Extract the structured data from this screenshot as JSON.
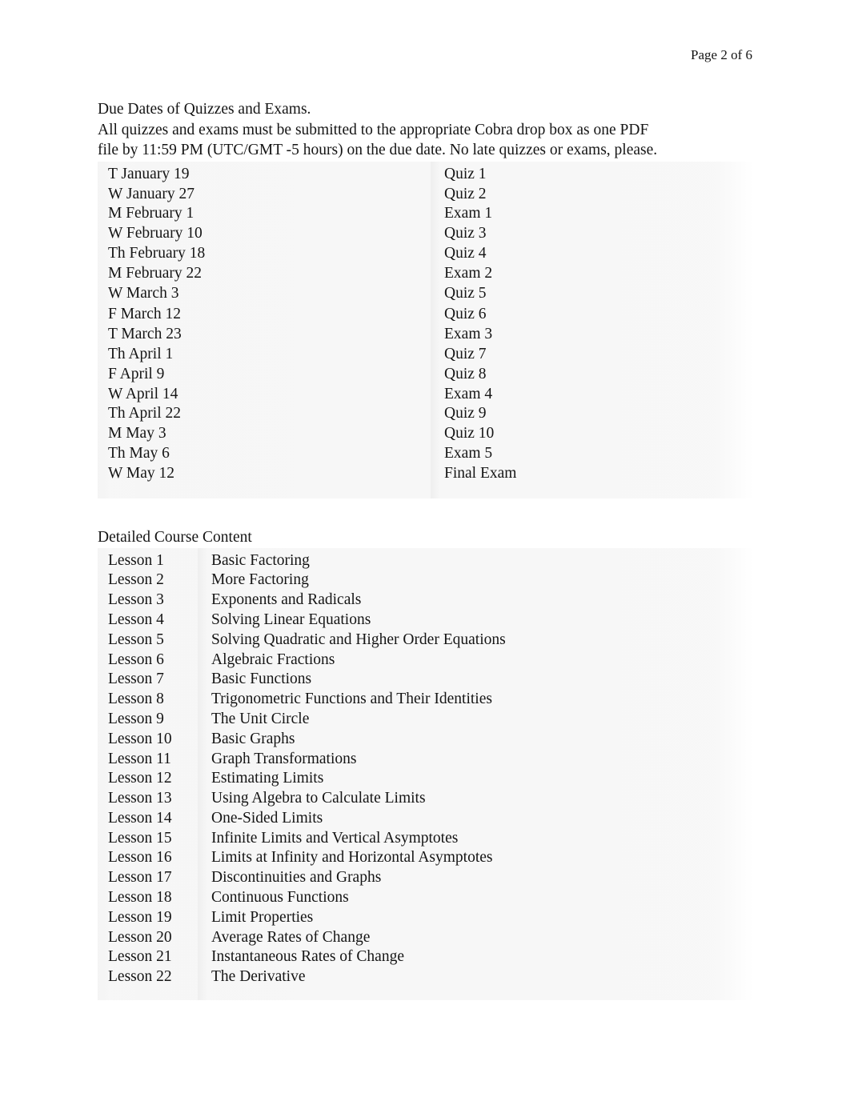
{
  "header": {
    "page_indicator": "Page 2 of 6"
  },
  "intro": {
    "heading": "Due Dates of Quizzes and Exams.",
    "line1": "All quizzes and exams must be submitted to the appropriate Cobra drop box as one PDF",
    "line2": "file by 11:59 PM (UTC/GMT -5 hours) on the due date. No late quizzes or exams, please."
  },
  "due_dates": {
    "rows": [
      {
        "date": "T January 19",
        "assessment": "Quiz 1"
      },
      {
        "date": "W January 27",
        "assessment": "Quiz 2"
      },
      {
        "date": "M February 1",
        "assessment": "Exam 1"
      },
      {
        "date": "W February 10",
        "assessment": "Quiz 3"
      },
      {
        "date": "Th February 18",
        "assessment": "Quiz 4"
      },
      {
        "date": "M February 22",
        "assessment": "Exam 2"
      },
      {
        "date": "W March 3",
        "assessment": "Quiz 5"
      },
      {
        "date": "F March 12",
        "assessment": "Quiz 6"
      },
      {
        "date": "T March 23",
        "assessment": "Exam 3"
      },
      {
        "date": "Th April 1",
        "assessment": "Quiz 7"
      },
      {
        "date": "F April 9",
        "assessment": "Quiz 8"
      },
      {
        "date": "W April 14",
        "assessment": "Exam 4"
      },
      {
        "date": "Th April 22",
        "assessment": "Quiz 9"
      },
      {
        "date": "M May 3",
        "assessment": "Quiz 10"
      },
      {
        "date": "Th May 6",
        "assessment": "Exam 5"
      },
      {
        "date": "W May 12",
        "assessment": "Final Exam"
      }
    ]
  },
  "course_content": {
    "heading": "Detailed Course Content",
    "rows": [
      {
        "lesson": "Lesson 1",
        "topic": "Basic Factoring"
      },
      {
        "lesson": "Lesson 2",
        "topic": "More Factoring"
      },
      {
        "lesson": "Lesson 3",
        "topic": "Exponents and Radicals"
      },
      {
        "lesson": "Lesson 4",
        "topic": "Solving Linear Equations"
      },
      {
        "lesson": "Lesson 5",
        "topic": "Solving Quadratic and Higher Order Equations"
      },
      {
        "lesson": "Lesson 6",
        "topic": "Algebraic Fractions"
      },
      {
        "lesson": "Lesson 7",
        "topic": "Basic Functions"
      },
      {
        "lesson": "Lesson 8",
        "topic": "Trigonometric Functions and Their Identities"
      },
      {
        "lesson": "Lesson 9",
        "topic": "The Unit Circle"
      },
      {
        "lesson": "Lesson 10",
        "topic": "Basic Graphs"
      },
      {
        "lesson": "Lesson 11",
        "topic": "Graph Transformations"
      },
      {
        "lesson": "Lesson 12",
        "topic": "Estimating Limits"
      },
      {
        "lesson": "Lesson 13",
        "topic": "Using Algebra to Calculate Limits"
      },
      {
        "lesson": "Lesson 14",
        "topic": "One-Sided Limits"
      },
      {
        "lesson": "Lesson 15",
        "topic": "Infinite Limits and Vertical Asymptotes"
      },
      {
        "lesson": "Lesson 16",
        "topic": "Limits at Infinity and Horizontal Asymptotes"
      },
      {
        "lesson": "Lesson 17",
        "topic": "Discontinuities and Graphs"
      },
      {
        "lesson": "Lesson 18",
        "topic": "Continuous Functions"
      },
      {
        "lesson": "Lesson 19",
        "topic": "Limit Properties"
      },
      {
        "lesson": "Lesson 20",
        "topic": "Average Rates of Change"
      },
      {
        "lesson": "Lesson 21",
        "topic": "Instantaneous Rates of Change"
      },
      {
        "lesson": "Lesson 22",
        "topic": "The Derivative"
      }
    ]
  }
}
